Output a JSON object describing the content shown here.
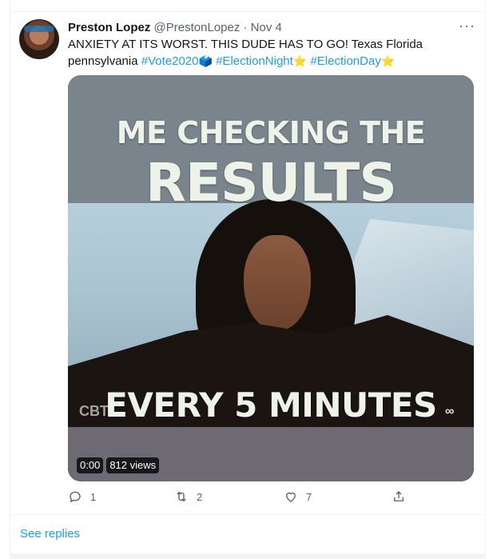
{
  "tweet": {
    "author_name": "Preston Lopez",
    "handle": "@PrestonLopez",
    "separator": "·",
    "date": "Nov 4",
    "text_plain_1": "ANXIETY AT ITS WORST. THIS DUDE HAS TO GO! Texas Florida",
    "text_plain_2": "pennsylvania",
    "hashtags": [
      "#Vote2020",
      "#ElectionNight",
      "#ElectionDay"
    ],
    "more_label": "···"
  },
  "media": {
    "caption_line1": "ME CHECKING THE",
    "caption_line2": "RESULTS",
    "caption_line3": "EVERY 5 MINUTES",
    "watermark_left": "CBT",
    "watermark_right": "∞",
    "duration": "0:00",
    "views": "812 views"
  },
  "actions": {
    "reply_count": "1",
    "retweet_count": "2",
    "like_count": "7"
  },
  "footer": {
    "see_replies": "See replies"
  },
  "colors": {
    "accent": "#1d9bf0",
    "muted": "#536471"
  }
}
